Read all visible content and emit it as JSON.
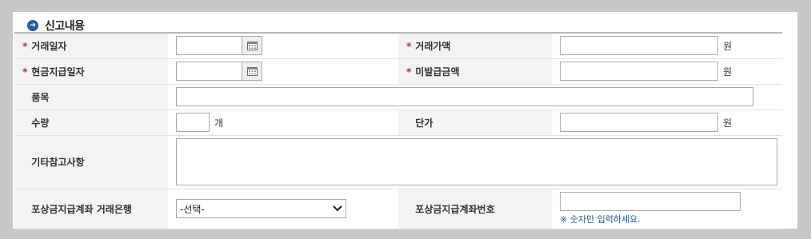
{
  "section": {
    "title": "신고내용"
  },
  "fields": {
    "trade_date": {
      "label": "거래일자",
      "value": ""
    },
    "trade_amount": {
      "label": "거래가액",
      "value": "",
      "unit": "원"
    },
    "cash_pay_date": {
      "label": "현금지급일자",
      "value": ""
    },
    "unpaid_amount": {
      "label": "미발급금액",
      "value": "",
      "unit": "원"
    },
    "item": {
      "label": "품목",
      "value": ""
    },
    "quantity": {
      "label": "수량",
      "value": "",
      "unit": "개"
    },
    "unit_price": {
      "label": "단가",
      "value": "",
      "unit": "원"
    },
    "remarks": {
      "label": "기타참고사항",
      "value": ""
    },
    "bank": {
      "label": "포상금지급계좌 거래은행",
      "selected": "-선택-"
    },
    "account_no": {
      "label": "포상금지급계좌번호",
      "value": "",
      "hint": "※ 숫자만 입력하세요."
    }
  },
  "required_mark": "*",
  "colors": {
    "required": "#c0282c",
    "accent": "#1e5fa8",
    "hint": "#1f5aa0"
  }
}
